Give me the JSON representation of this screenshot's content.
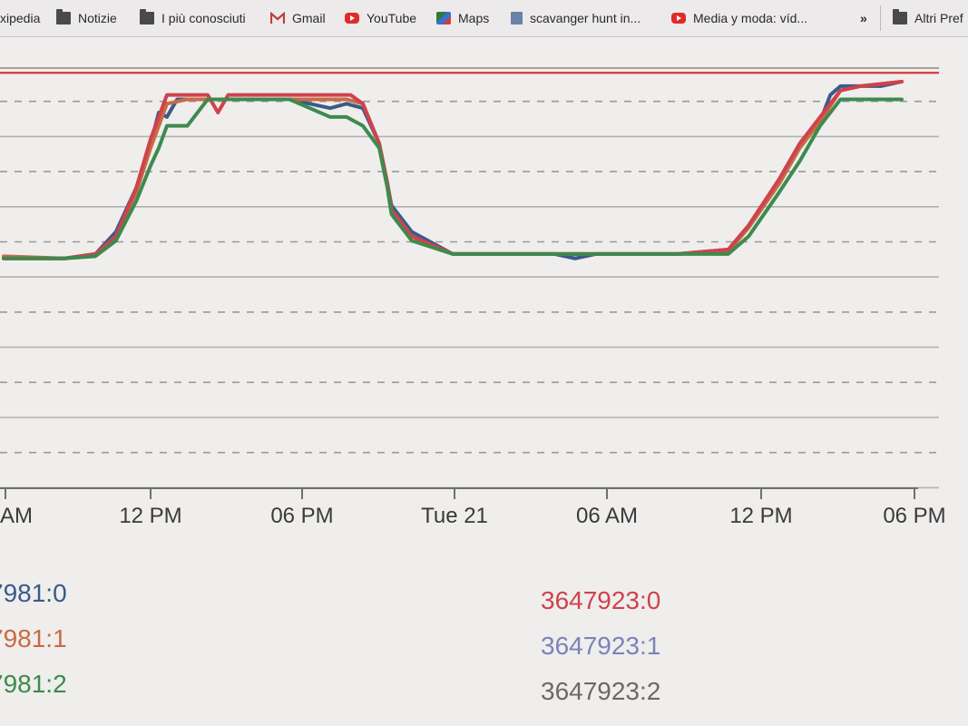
{
  "bookmarks": [
    {
      "label": "xipedia",
      "icon": "none"
    },
    {
      "label": "Notizie",
      "icon": "folder-icon"
    },
    {
      "label": "I più conosciuti",
      "icon": "folder-icon"
    },
    {
      "label": "Gmail",
      "icon": "gmail-icon"
    },
    {
      "label": "YouTube",
      "icon": "youtube-icon"
    },
    {
      "label": "Maps",
      "icon": "maps-icon"
    },
    {
      "label": "scavanger hunt in...",
      "icon": "doc-icon"
    },
    {
      "label": "Media y moda: víd...",
      "icon": "youtube-icon"
    }
  ],
  "overflow_label": "»",
  "other_bookmarks": "Altri Pref",
  "chart_data": {
    "type": "line",
    "title": "",
    "xlabel": "",
    "ylabel": "",
    "x_ticks": [
      "AM",
      "12 PM",
      "06 PM",
      "Tue 21",
      "06 AM",
      "12 PM",
      "06 PM"
    ],
    "x_units": "hours from 06 AM Mon 20",
    "ylim": [
      0,
      10
    ],
    "threshold": {
      "value": 9.4,
      "color": "#d63a3a"
    },
    "grid": true,
    "series": [
      {
        "name": "7981:0",
        "color": "#3b5a8a",
        "x": [
          0,
          3,
          4.5,
          5.5,
          6.5,
          7.2,
          7.6,
          8,
          8.5,
          9,
          11,
          12,
          14,
          16,
          16.8,
          17.6,
          18.4,
          18.8,
          19,
          20,
          22,
          24,
          25,
          26,
          27,
          28,
          29,
          30,
          31,
          32,
          33,
          35.5,
          36.5,
          38,
          39,
          40,
          40.5,
          41,
          42,
          43,
          44
        ],
        "y": [
          5.2,
          5.2,
          5.3,
          5.8,
          6.8,
          7.8,
          8.5,
          8.4,
          8.8,
          8.8,
          8.8,
          8.8,
          8.8,
          8.6,
          8.7,
          8.6,
          7.8,
          6.9,
          6.4,
          5.8,
          5.3,
          5.3,
          5.3,
          5.3,
          5.3,
          5.2,
          5.3,
          5.3,
          5.3,
          5.3,
          5.3,
          5.4,
          5.9,
          6.9,
          7.7,
          8.3,
          8.9,
          9.1,
          9.1,
          9.1,
          9.2
        ]
      },
      {
        "name": "7981:1",
        "color": "#c86b45",
        "x": [
          0,
          3,
          4.5,
          5.5,
          6.5,
          7.2,
          8,
          9,
          11,
          12,
          14,
          16,
          16.8,
          17.6,
          18.4,
          18.8,
          19,
          20,
          22,
          24,
          26,
          28,
          30,
          32,
          33,
          35.5,
          36.5,
          38,
          39,
          40,
          41,
          42,
          44
        ],
        "y": [
          5.25,
          5.2,
          5.3,
          5.7,
          6.7,
          7.7,
          8.7,
          8.8,
          8.8,
          8.8,
          8.8,
          8.8,
          8.8,
          8.7,
          7.8,
          6.9,
          6.3,
          5.7,
          5.3,
          5.3,
          5.3,
          5.3,
          5.3,
          5.3,
          5.3,
          5.35,
          5.9,
          6.9,
          7.7,
          8.3,
          9.0,
          9.1,
          9.2
        ]
      },
      {
        "name": "7981:2",
        "color": "#3e8a4e",
        "x": [
          0,
          3,
          4.5,
          5.5,
          6.5,
          7.2,
          7.6,
          8,
          9,
          10,
          11,
          12,
          14,
          15,
          16,
          16.4,
          16.8,
          17.6,
          18.4,
          18.8,
          19,
          20,
          22,
          24,
          26,
          28,
          30,
          32,
          33,
          35.5,
          36.5,
          38,
          39,
          40,
          41,
          42,
          44
        ],
        "y": [
          5.2,
          5.2,
          5.25,
          5.6,
          6.5,
          7.3,
          7.7,
          8.2,
          8.2,
          8.8,
          8.8,
          8.8,
          8.8,
          8.6,
          8.4,
          8.4,
          8.4,
          8.2,
          7.7,
          6.8,
          6.2,
          5.6,
          5.3,
          5.3,
          5.3,
          5.3,
          5.3,
          5.3,
          5.3,
          5.3,
          5.7,
          6.7,
          7.4,
          8.2,
          8.8,
          8.8,
          8.8
        ]
      },
      {
        "name": "3647923:0",
        "color": "#d0424c",
        "x": [
          0,
          3,
          4.5,
          5.5,
          6.5,
          7.2,
          8,
          9,
          10,
          10.5,
          11,
          12,
          14,
          16,
          17,
          17.6,
          18.4,
          18.8,
          19,
          20,
          22,
          24,
          26,
          28,
          30,
          32,
          33,
          35.5,
          36.5,
          38,
          39,
          40,
          41,
          42,
          44
        ],
        "y": [
          5.2,
          5.2,
          5.3,
          5.7,
          6.8,
          7.9,
          8.9,
          8.9,
          8.9,
          8.5,
          8.9,
          8.9,
          8.9,
          8.9,
          8.9,
          8.7,
          7.8,
          6.9,
          6.3,
          5.7,
          5.3,
          5.3,
          5.3,
          5.3,
          5.3,
          5.3,
          5.3,
          5.4,
          5.95,
          7.0,
          7.8,
          8.4,
          9.0,
          9.1,
          9.2
        ]
      },
      {
        "name": "3647923:1",
        "color": "#7d82b9",
        "x": [],
        "y": []
      },
      {
        "name": "3647923:2",
        "color": "#6e6868",
        "x": [],
        "y": []
      }
    ]
  }
}
